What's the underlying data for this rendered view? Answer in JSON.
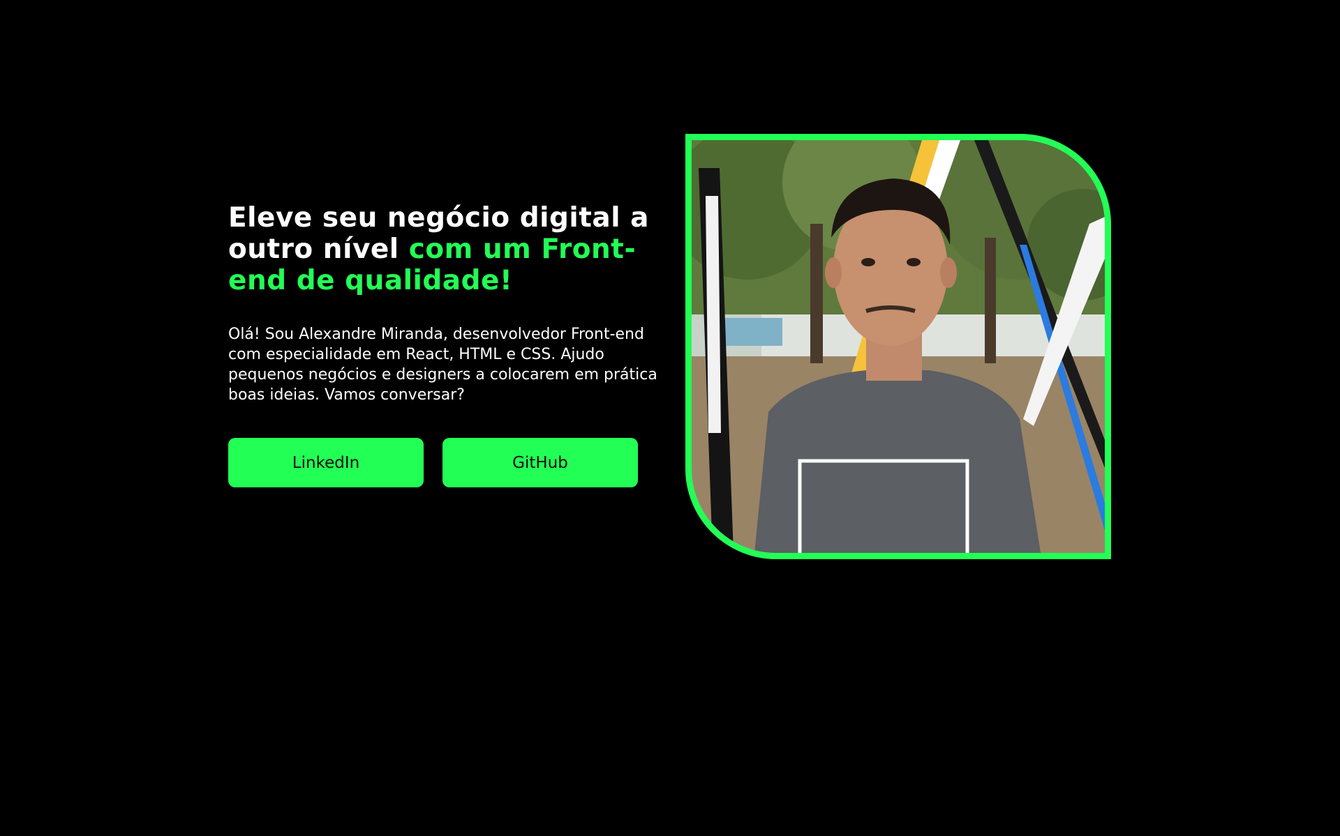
{
  "hero": {
    "headline_white": "Eleve seu negócio digital a outro nível ",
    "headline_accent": "com um Front-end de qualidade!",
    "intro": "Olá! Sou Alexandre Miranda, desenvolvedor Front-end com especialidade em React, HTML e CSS. Ajudo pequenos negócios e designers a colocarem em prática boas ideias. Vamos conversar?",
    "buttons": {
      "linkedin_label": "LinkedIn",
      "github_label": "GitHub"
    },
    "photo": {
      "alt": "Alexandre Miranda"
    }
  },
  "colors": {
    "accent": "#22ff55",
    "background": "#000000",
    "text": "#ffffff"
  }
}
